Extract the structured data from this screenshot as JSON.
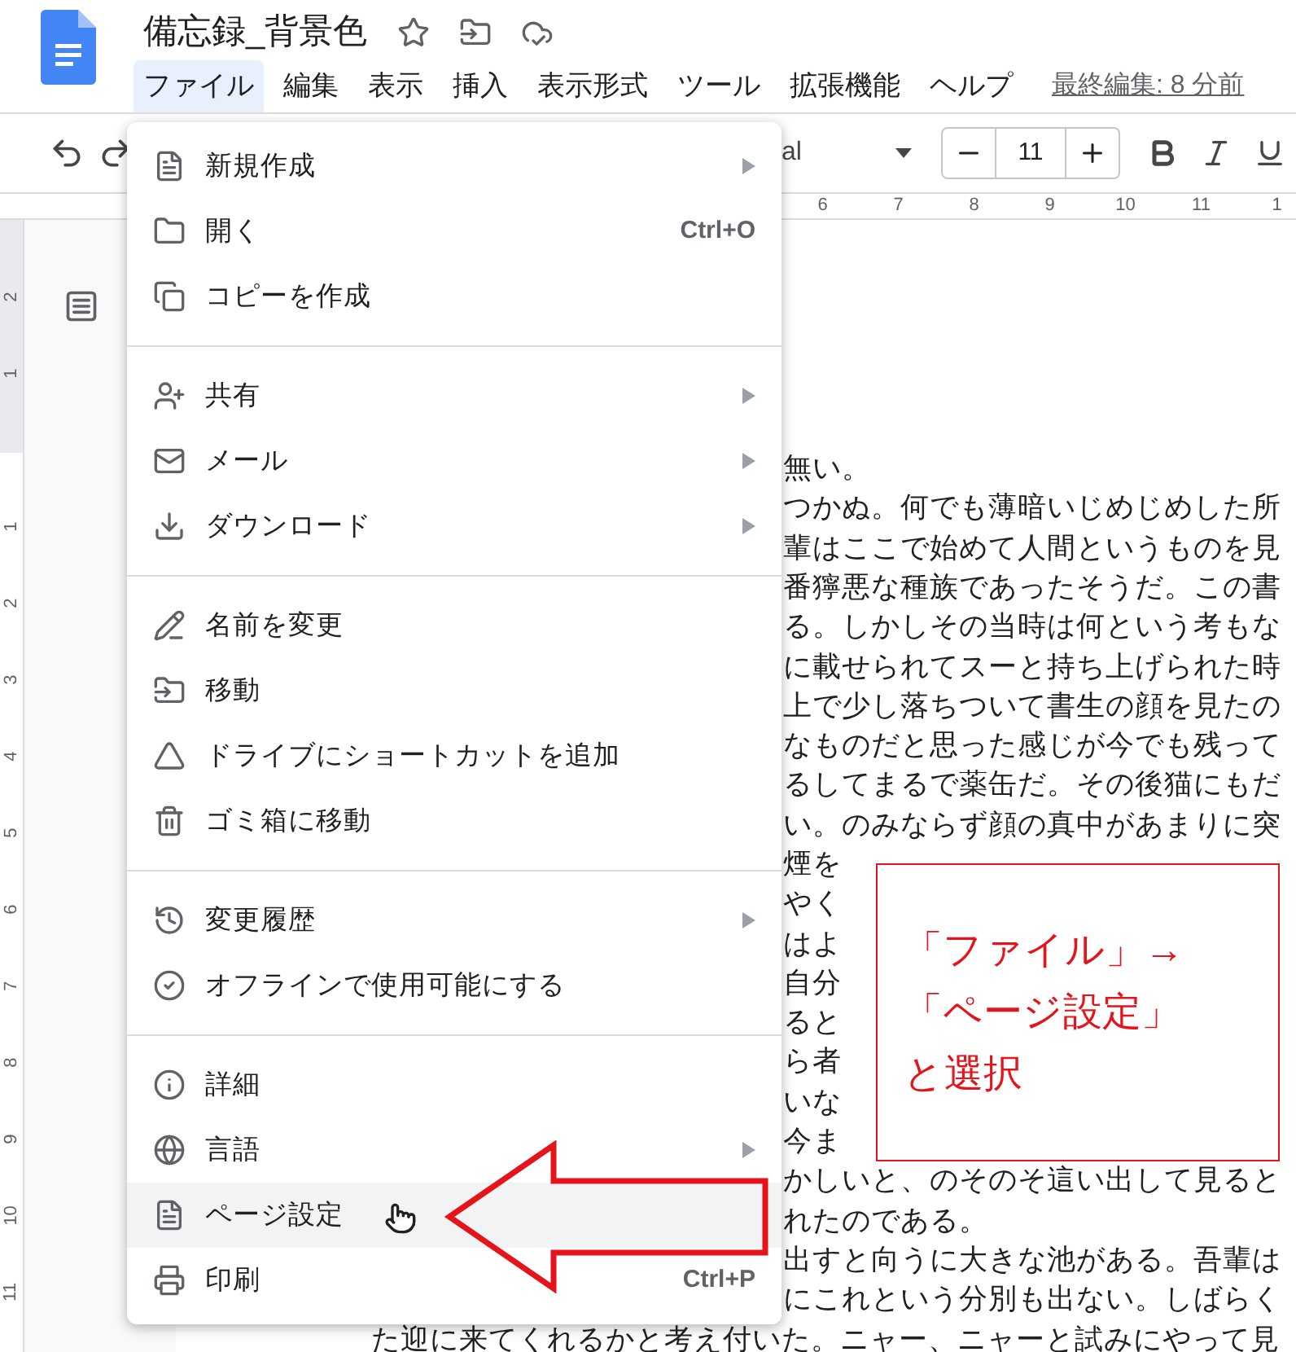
{
  "header": {
    "title": "備忘録_背景色",
    "menus": [
      {
        "label": "ファイル",
        "selected": true
      },
      {
        "label": "編集",
        "selected": false
      },
      {
        "label": "表示",
        "selected": false
      },
      {
        "label": "挿入",
        "selected": false
      },
      {
        "label": "表示形式",
        "selected": false
      },
      {
        "label": "ツール",
        "selected": false
      },
      {
        "label": "拡張機能",
        "selected": false
      },
      {
        "label": "ヘルプ",
        "selected": false
      }
    ],
    "last_edit": "最終編集: 8 分前"
  },
  "toolbar": {
    "font": "al",
    "font_size": "11"
  },
  "ruler": {
    "marks": [
      "6",
      "7",
      "8",
      "9",
      "10",
      "11",
      "1"
    ]
  },
  "vertical_ruler": {
    "upper": [
      "2",
      "1"
    ],
    "lower": [
      "1",
      "2",
      "3",
      "4",
      "5",
      "6",
      "7",
      "8",
      "9",
      "10",
      "11"
    ]
  },
  "file_menu": {
    "sections": [
      [
        {
          "label": "新規作成",
          "submenu": true,
          "selected": false
        },
        {
          "label": "開く",
          "shortcut": "Ctrl+O",
          "submenu": false,
          "selected": false
        },
        {
          "label": "コピーを作成",
          "submenu": false,
          "selected": false
        }
      ],
      [
        {
          "label": "共有",
          "submenu": true,
          "selected": false
        },
        {
          "label": "メール",
          "submenu": true,
          "selected": false
        },
        {
          "label": "ダウンロード",
          "submenu": true,
          "selected": false
        }
      ],
      [
        {
          "label": "名前を変更",
          "submenu": false,
          "selected": false
        },
        {
          "label": "移動",
          "submenu": false,
          "selected": false
        },
        {
          "label": "ドライブにショートカットを追加",
          "submenu": false,
          "selected": false
        },
        {
          "label": "ゴミ箱に移動",
          "submenu": false,
          "selected": false
        }
      ],
      [
        {
          "label": "変更履歴",
          "submenu": true,
          "selected": false
        },
        {
          "label": "オフラインで使用可能にする",
          "submenu": false,
          "selected": false
        }
      ],
      [
        {
          "label": "詳細",
          "submenu": false,
          "selected": false
        },
        {
          "label": "言語",
          "submenu": true,
          "selected": false
        },
        {
          "label": "ページ設定",
          "submenu": false,
          "selected": true
        },
        {
          "label": "印刷",
          "shortcut": "Ctrl+P",
          "submenu": false,
          "selected": false
        }
      ]
    ]
  },
  "document": {
    "lines": [
      {
        "kind": "partial",
        "text": "無い。"
      },
      {
        "kind": "partial",
        "text": "つかぬ。何でも薄暗いじめじめした所"
      },
      {
        "kind": "partial",
        "text": "輩はここで始めて人間というものを見"
      },
      {
        "kind": "partial",
        "text": "番獰悪な種族であったそうだ。この書"
      },
      {
        "kind": "partial",
        "text": "る。しかしその当時は何という考もな"
      },
      {
        "kind": "partial",
        "text": "に載せられてスーと持ち上げられた時"
      },
      {
        "kind": "partial",
        "text": "上で少し落ちついて書生の顔を見たの"
      },
      {
        "kind": "partial",
        "text": "なものだと思った感じが今でも残って"
      },
      {
        "kind": "partial",
        "text": "るしてまるで薬缶だ。その後猫にもだ"
      },
      {
        "kind": "partial",
        "text": "い。のみならず顔の真中があまりに突"
      },
      {
        "kind": "partial",
        "text": "煙を"
      },
      {
        "kind": "partial",
        "text": "やく"
      },
      {
        "kind": "partial",
        "text": "はよ"
      },
      {
        "kind": "partial",
        "text": "自分"
      },
      {
        "kind": "partial",
        "text": "ると"
      },
      {
        "kind": "partial",
        "text": "ら者"
      },
      {
        "kind": "partial",
        "text": "いな"
      },
      {
        "kind": "partial",
        "text": "今ま"
      },
      {
        "kind": "partial",
        "text": "かしいと、のそのそ這い出して見ると"
      },
      {
        "kind": "partial",
        "text": "れたのである。"
      },
      {
        "kind": "partial",
        "text": "出すと向うに大きな池がある。吾輩は"
      },
      {
        "kind": "partial",
        "text": "にこれという分別も出ない。しばらく"
      },
      {
        "kind": "full",
        "text": "た迎に来てくれるかと考え付いた。ニャー、ニャーと試みにやって見"
      }
    ]
  },
  "annotation": {
    "lines": [
      "「ファイル」→",
      "「ページ設定」",
      "と選択"
    ]
  }
}
